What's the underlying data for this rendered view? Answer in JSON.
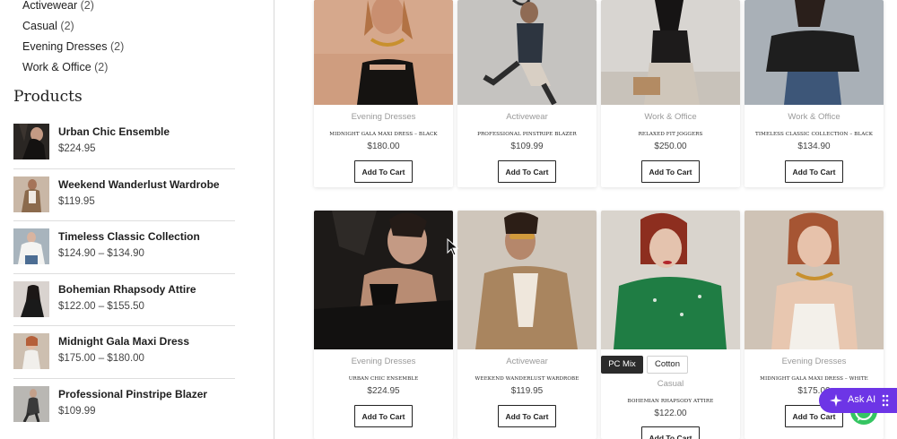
{
  "sidebar": {
    "categories": [
      {
        "name": "Activewear",
        "count": "(2)"
      },
      {
        "name": "Casual",
        "count": "(2)"
      },
      {
        "name": "Evening Dresses",
        "count": "(2)"
      },
      {
        "name": "Work & Office",
        "count": "(2)"
      }
    ],
    "products_heading": "Products",
    "products": [
      {
        "name": "Urban Chic Ensemble",
        "price": "$224.95"
      },
      {
        "name": "Weekend Wanderlust Wardrobe",
        "price": "$119.95"
      },
      {
        "name": "Timeless Classic Collection",
        "price": "$124.90 – $134.90"
      },
      {
        "name": "Bohemian Rhapsody Attire",
        "price": "$122.00 – $155.50"
      },
      {
        "name": "Midnight Gala Maxi Dress",
        "price": "$175.00 – $180.00"
      },
      {
        "name": "Professional Pinstripe Blazer",
        "price": "$109.99"
      }
    ]
  },
  "grid": {
    "cards": [
      {
        "category": "Evening Dresses",
        "title": "Midnight Gala Maxi Dress – Black",
        "price": "$180.00",
        "button": "Add To Cart"
      },
      {
        "category": "Activewear",
        "title": "Professional Pinstripe Blazer",
        "price": "$109.99",
        "button": "Add To Cart"
      },
      {
        "category": "Work & Office",
        "title": "Relaxed Fit Joggers",
        "price": "$250.00",
        "button": "Add To Cart"
      },
      {
        "category": "Work & Office",
        "title": "Timeless Classic Collection – Black",
        "price": "$134.90",
        "button": "Add To Cart"
      },
      {
        "category": "Evening Dresses",
        "title": "Urban Chic Ensemble",
        "price": "$224.95",
        "button": "Add To Cart"
      },
      {
        "category": "Activewear",
        "title": "Weekend Wanderlust Wardrobe",
        "price": "$119.95",
        "button": "Add To Cart"
      },
      {
        "category": "Casual",
        "title": "Bohemian Rhapsody Attire",
        "price": "$122.00",
        "button": "Add To Cart",
        "variants": [
          {
            "label": "PC Mix",
            "selected": true
          },
          {
            "label": "Cotton",
            "selected": false
          }
        ]
      },
      {
        "category": "Evening Dresses",
        "title": "Midnight Gala Maxi Dress – White",
        "price": "$175.00",
        "button": "Add To Cart"
      }
    ]
  },
  "widgets": {
    "ask_ai_label": "Ask AI",
    "ask_ai_color": "#6d35e6",
    "whatsapp_color": "#35c562"
  },
  "icons": [
    "sparkle-icon",
    "drag-grip-icon",
    "whatsapp-icon",
    "mouse-cursor-icon"
  ]
}
